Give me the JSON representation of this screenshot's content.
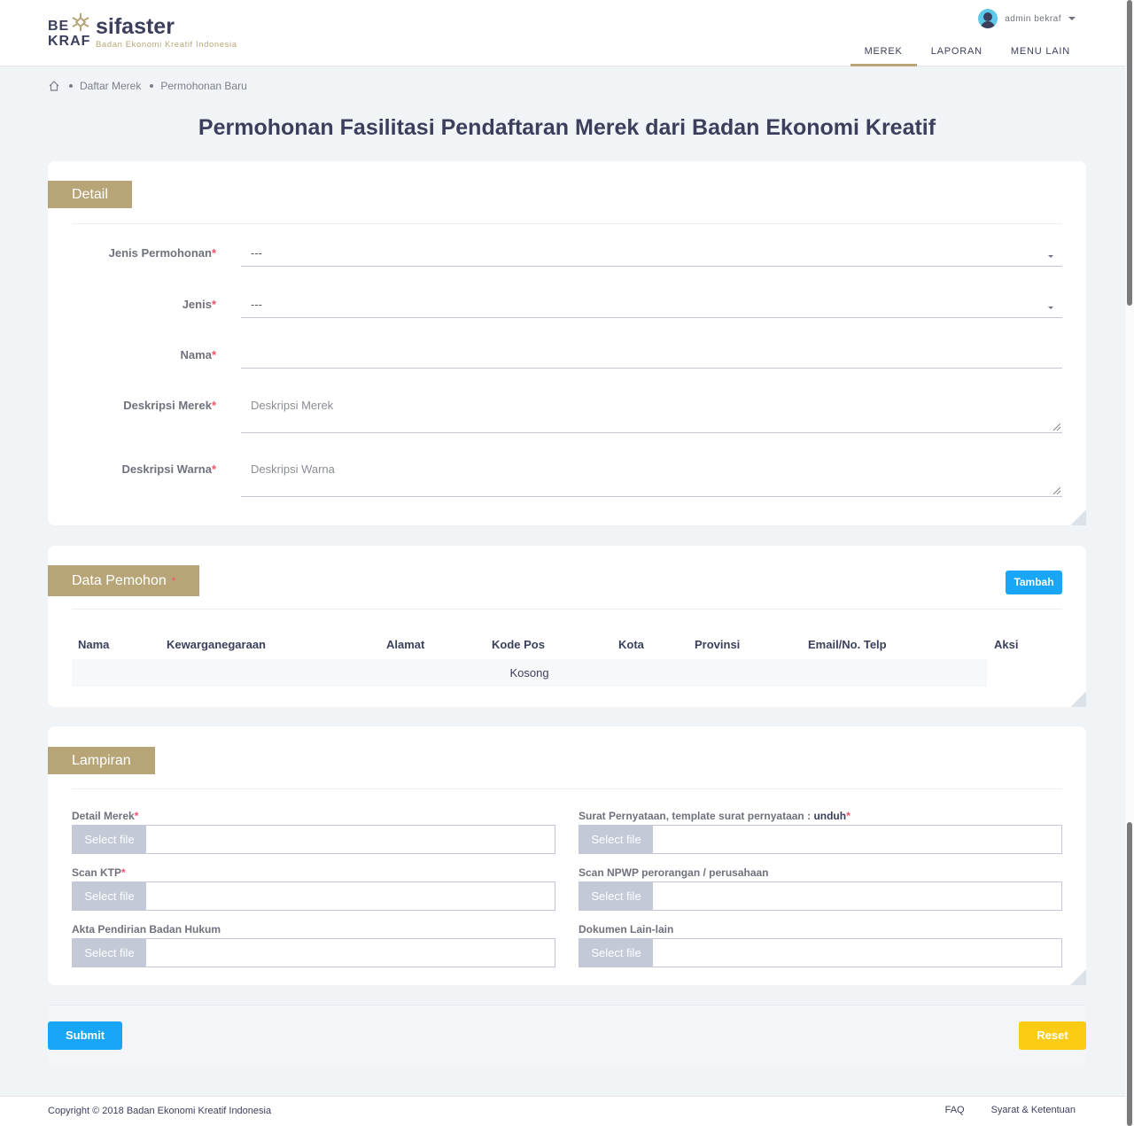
{
  "header": {
    "logo": {
      "be": "BE",
      "kraf": "KRAF",
      "brand": "sifaster",
      "tagline": "Badan Ekonomi Kreatif Indonesia"
    },
    "user": {
      "name": "admin bekraf"
    },
    "nav": [
      "MEREK",
      "LAPORAN",
      "MENU LAIN"
    ],
    "active_nav": "MEREK"
  },
  "breadcrumb": [
    "Daftar Merek",
    "Permohonan Baru"
  ],
  "page_title": "Permohonan Fasilitasi Pendaftaran Merek dari Badan Ekonomi Kreatif",
  "detail": {
    "title": "Detail",
    "fields": {
      "jenis_permohonan": {
        "label": "Jenis Permohonan",
        "value": "---"
      },
      "jenis": {
        "label": "Jenis",
        "value": "---"
      },
      "nama": {
        "label": "Nama",
        "value": ""
      },
      "deskripsi_merek": {
        "label": "Deskripsi Merek",
        "placeholder": "Deskripsi Merek"
      },
      "deskripsi_warna": {
        "label": "Deskripsi Warna",
        "placeholder": "Deskripsi Warna"
      }
    }
  },
  "pemohon": {
    "title": "Data Pemohon",
    "required_mark": "*",
    "add_label": "Tambah",
    "columns": [
      "Nama",
      "Kewarganegaraan",
      "Alamat",
      "Kode Pos",
      "Kota",
      "Provinsi",
      "Email/No. Telp",
      "Aksi"
    ],
    "empty_text": "Kosong"
  },
  "lampiran": {
    "title": "Lampiran",
    "button_label": "Select file",
    "fields": {
      "detail_merek": "Detail Merek",
      "surat_pernyataan": "Surat Pernyataan, template surat pernyataan : ",
      "surat_link": "unduh",
      "scan_ktp": "Scan KTP",
      "scan_npwp": "Scan NPWP perorangan / perusahaan",
      "akta": "Akta Pendirian Badan Hukum",
      "dokumen_lain": "Dokumen Lain-lain"
    }
  },
  "actions": {
    "submit": "Submit",
    "reset": "Reset"
  },
  "footer": {
    "copyright": "Copyright © 2018 Badan Ekonomi Kreatif Indonesia",
    "links": [
      "FAQ",
      "Syarat & Ketentuan"
    ]
  },
  "colors": {
    "accent": "#b7a577",
    "primary": "#19a6f6",
    "warning": "#fccc15",
    "required": "#f4516c"
  }
}
